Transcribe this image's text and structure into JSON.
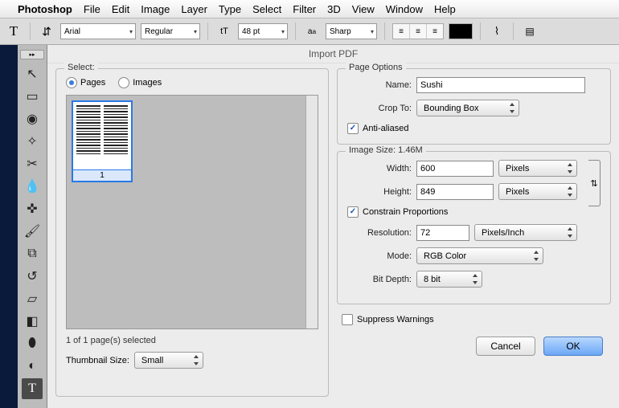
{
  "menubar": {
    "app": "Photoshop",
    "items": [
      "File",
      "Edit",
      "Image",
      "Layer",
      "Type",
      "Select",
      "Filter",
      "3D",
      "View",
      "Window",
      "Help"
    ]
  },
  "optbar": {
    "font": "Arial",
    "weight": "Regular",
    "size": "48 pt",
    "aa": "Sharp"
  },
  "dialog": {
    "title": "Import PDF",
    "select": {
      "legend": "Select:",
      "pages_label": "Pages",
      "images_label": "Images",
      "mode": "pages",
      "thumb_label": "1",
      "status": "1 of 1 page(s) selected",
      "thumb_size_label": "Thumbnail Size:",
      "thumb_size_value": "Small"
    },
    "page_options": {
      "legend": "Page Options",
      "name_label": "Name:",
      "name_value": "Sushi",
      "crop_label": "Crop To:",
      "crop_value": "Bounding Box",
      "anti_aliased_label": "Anti-aliased",
      "anti_aliased": true
    },
    "image_size": {
      "legend": "Image Size: 1.46M",
      "width_label": "Width:",
      "width_value": "600",
      "width_unit": "Pixels",
      "height_label": "Height:",
      "height_value": "849",
      "height_unit": "Pixels",
      "constrain_label": "Constrain Proportions",
      "constrain": true,
      "res_label": "Resolution:",
      "res_value": "72",
      "res_unit": "Pixels/Inch",
      "mode_label": "Mode:",
      "mode_value": "RGB Color",
      "bit_label": "Bit Depth:",
      "bit_value": "8 bit"
    },
    "suppress_label": "Suppress Warnings",
    "suppress": false,
    "cancel": "Cancel",
    "ok": "OK"
  }
}
